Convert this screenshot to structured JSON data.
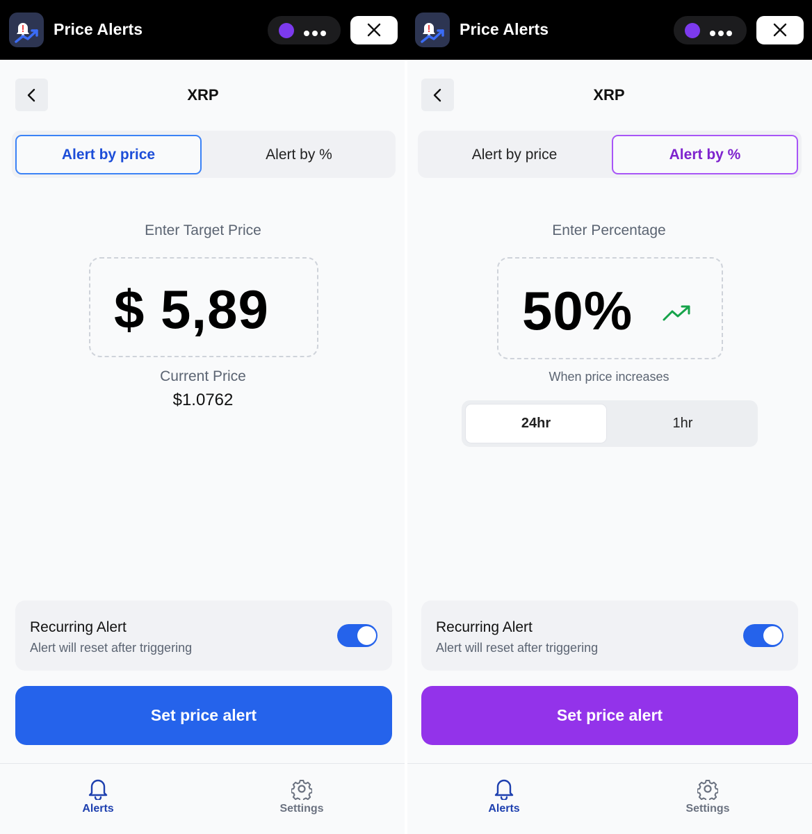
{
  "header": {
    "app_title": "Price Alerts"
  },
  "screens": [
    {
      "title": "XRP",
      "tabs": [
        {
          "label": "Alert by price",
          "active": true
        },
        {
          "label": "Alert by %",
          "active": false
        }
      ],
      "field_label": "Enter Target Price",
      "amount": "$ 5,89",
      "current_price_label": "Current Price",
      "current_price": "$1.0762",
      "recurring": {
        "title": "Recurring Alert",
        "subtitle": "Alert will reset after triggering",
        "enabled": true
      },
      "submit_label": "Set price alert",
      "accent_color": "#2563eb"
    },
    {
      "title": "XRP",
      "tabs": [
        {
          "label": "Alert by price",
          "active": false
        },
        {
          "label": "Alert by %",
          "active": true
        }
      ],
      "field_label": "Enter Percentage",
      "amount": "50%",
      "trend_icon": "trending-up-icon",
      "direction_text": "When price increases",
      "periods": [
        {
          "label": "24hr",
          "selected": true
        },
        {
          "label": "1hr",
          "selected": false
        }
      ],
      "recurring": {
        "title": "Recurring Alert",
        "subtitle": "Alert will reset after triggering",
        "enabled": true
      },
      "submit_label": "Set price alert",
      "accent_color": "#9333ea"
    }
  ],
  "bottom_nav": {
    "items": [
      {
        "label": "Alerts",
        "icon": "bell-icon",
        "active": true
      },
      {
        "label": "Settings",
        "icon": "gear-icon",
        "active": false
      }
    ]
  },
  "colors": {
    "header_bg": "#000000",
    "pill_dot": "#7c3aed",
    "toggle_on": "#2563eb",
    "trend_green": "#16a34a"
  }
}
